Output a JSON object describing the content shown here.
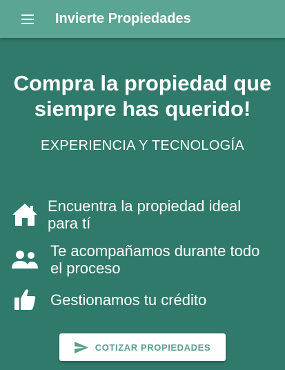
{
  "app_bar": {
    "title": "Invierte Propiedades",
    "menu_icon": "menu-icon"
  },
  "hero": {
    "title": "Compra la propiedad que siempre has querido!",
    "subtitle": "EXPERIENCIA Y TECNOLOGÍA"
  },
  "features": [
    {
      "icon": "house-icon",
      "text": "Encuentra la propiedad ideal para tí"
    },
    {
      "icon": "people-icon",
      "text": "Te acompañamos durante todo el proceso"
    },
    {
      "icon": "thumbs-up-icon",
      "text": "Gestionamos tu crédito"
    }
  ],
  "cta": {
    "icon": "send-icon",
    "label": "COTIZAR PROPIEDADES"
  },
  "colors": {
    "app_bar": "#5aa593",
    "background": "#2f7a6a",
    "button_text": "#5c9e8e"
  }
}
